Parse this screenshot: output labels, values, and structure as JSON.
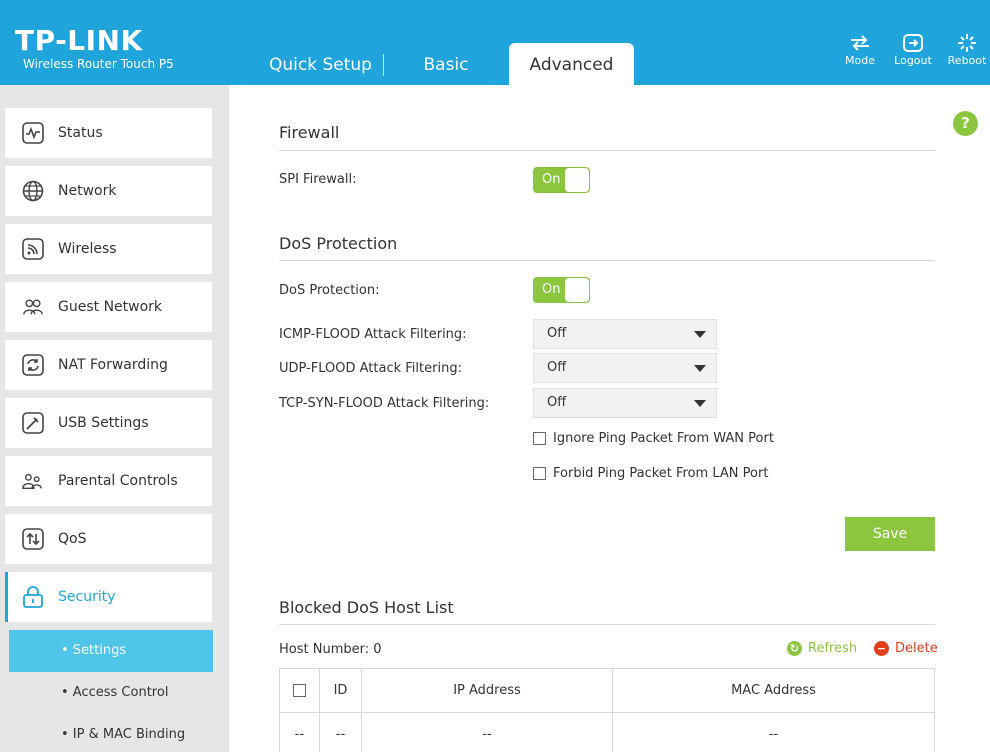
{
  "header": {
    "logo": "TP-LINK",
    "model": "Wireless Router Touch P5",
    "tabs": [
      {
        "label": "Quick Setup",
        "active": false
      },
      {
        "label": "Basic",
        "active": false
      },
      {
        "label": "Advanced",
        "active": true
      }
    ],
    "buttons": [
      {
        "label": "Mode",
        "icon": "mode-icon"
      },
      {
        "label": "Logout",
        "icon": "logout-icon"
      },
      {
        "label": "Reboot",
        "icon": "reboot-icon"
      }
    ]
  },
  "sidebar": {
    "items": [
      {
        "label": "Status",
        "icon": "status-icon"
      },
      {
        "label": "Network",
        "icon": "globe-icon"
      },
      {
        "label": "Wireless",
        "icon": "wireless-icon"
      },
      {
        "label": "Guest Network",
        "icon": "guest-icon"
      },
      {
        "label": "NAT Forwarding",
        "icon": "nat-icon"
      },
      {
        "label": "USB Settings",
        "icon": "usb-icon"
      },
      {
        "label": "Parental Controls",
        "icon": "parental-icon"
      },
      {
        "label": "QoS",
        "icon": "qos-icon"
      },
      {
        "label": "Security",
        "icon": "lock-icon",
        "active": true
      }
    ],
    "subitems": [
      {
        "label": "• Settings",
        "active": true
      },
      {
        "label": "• Access Control",
        "active": false
      },
      {
        "label": "• IP & MAC Binding",
        "active": false
      }
    ]
  },
  "firewall": {
    "title": "Firewall",
    "spi_label": "SPI Firewall:",
    "spi_state": "On"
  },
  "dos": {
    "title": "DoS Protection",
    "dos_label": "DoS Protection:",
    "dos_state": "On",
    "filters": [
      {
        "label": "ICMP-FLOOD Attack Filtering:",
        "value": "Off"
      },
      {
        "label": "UDP-FLOOD Attack Filtering:",
        "value": "Off"
      },
      {
        "label": "TCP-SYN-FLOOD Attack Filtering:",
        "value": "Off"
      }
    ],
    "checks": [
      {
        "label": "Ignore Ping Packet From WAN Port",
        "checked": false
      },
      {
        "label": "Forbid Ping Packet From LAN Port",
        "checked": false
      }
    ],
    "save_label": "Save"
  },
  "blocked": {
    "title": "Blocked DoS Host List",
    "host_number": "Host Number: 0",
    "refresh_label": "Refresh",
    "delete_label": "Delete",
    "columns": [
      "ID",
      "IP Address",
      "MAC Address"
    ],
    "rows": [
      {
        "check": "--",
        "id": "--",
        "ip": "--",
        "mac": "--"
      }
    ]
  },
  "colors": {
    "header_blue": "#1fa5dc",
    "accent_green": "#8cc63f",
    "delete_red": "#e2401c",
    "subitem_active": "#4ec5e9"
  }
}
